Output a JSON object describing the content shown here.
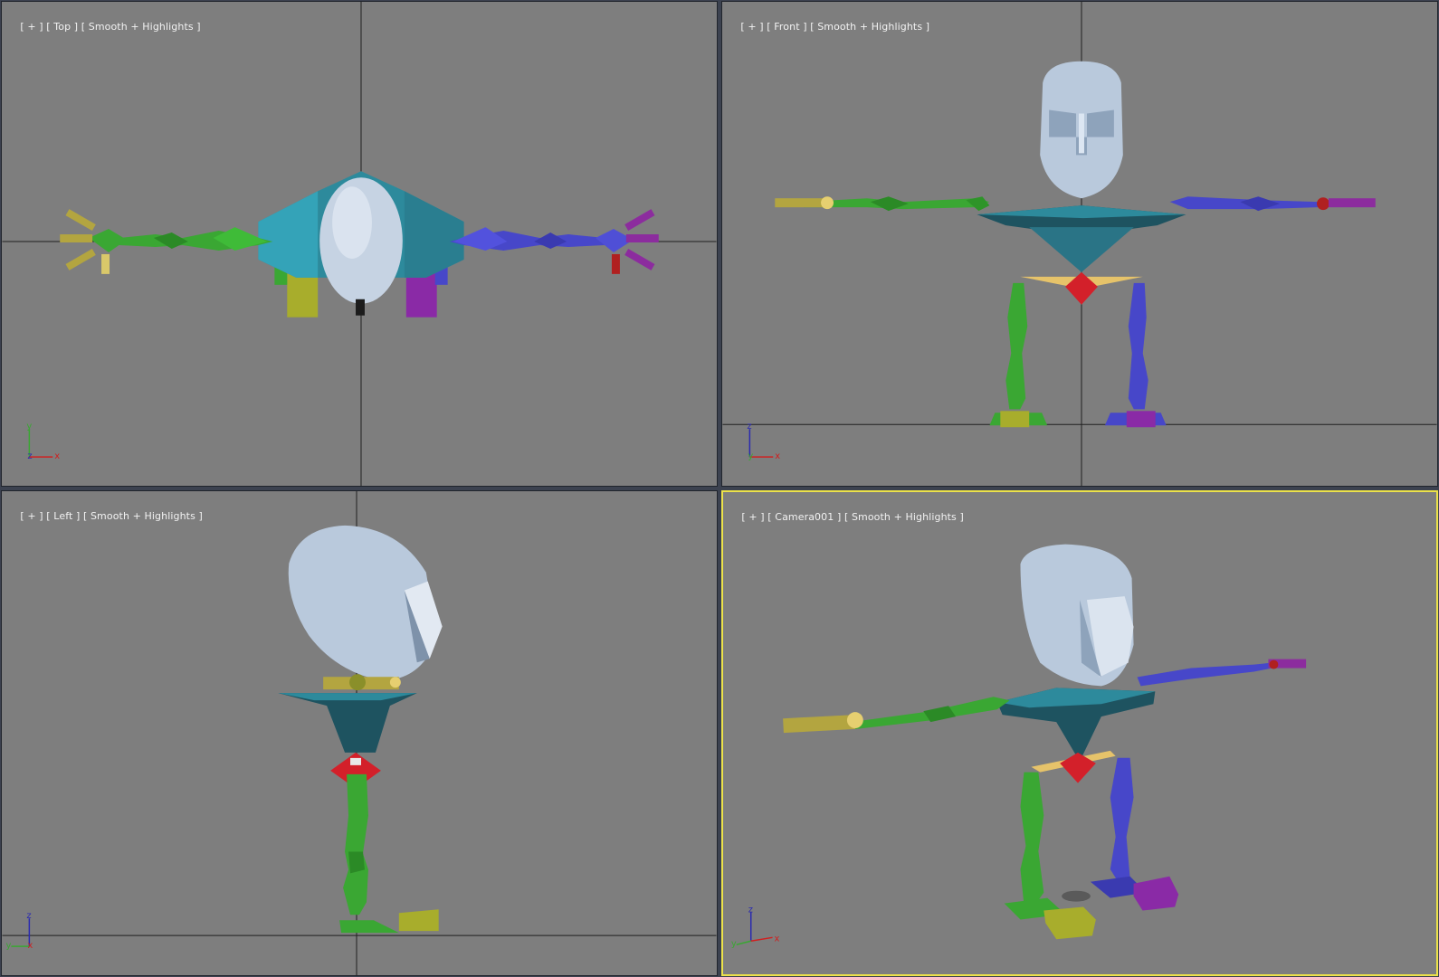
{
  "viewports": [
    {
      "id": "top",
      "bracket_plus": "[ + ]",
      "view": "[ Top ]",
      "shading": "[ Smooth + Highlights ]",
      "axes": {
        "a": "y",
        "b": "z",
        "c": "x"
      }
    },
    {
      "id": "front",
      "bracket_plus": "[ + ]",
      "view": "[ Front ]",
      "shading": "[ Smooth + Highlights ]",
      "axes": {
        "a": "z",
        "b": "y",
        "c": "x"
      }
    },
    {
      "id": "left",
      "bracket_plus": "[ + ]",
      "view": "[ Left ]",
      "shading": "[ Smooth + Highlights ]",
      "axes": {
        "a": "z",
        "b": "y",
        "c": "x"
      }
    },
    {
      "id": "camera",
      "bracket_plus": "[ + ]",
      "view": "[ Camera001 ]",
      "shading": "[ Smooth + Highlights ]",
      "axes": {
        "a": "z",
        "b": "y",
        "c": "x"
      },
      "active": true
    }
  ],
  "colors": {
    "viewport_bg": "#7e7e7e",
    "active_border": "#ece24a",
    "grid_line": "#202020",
    "head": "#b9c9dc",
    "torso": "#2d8a9c",
    "torso_dark": "#1e5360",
    "pelvis": "#d3202a",
    "hip_bar": "#e6c36a",
    "left_limb": "#3aa733",
    "right_limb": "#4747c9",
    "left_foot": "#a8ad2c",
    "right_foot": "#8a2aa6",
    "hand_yellow": "#b3a540",
    "hand_purple": "#8c2c9e"
  }
}
